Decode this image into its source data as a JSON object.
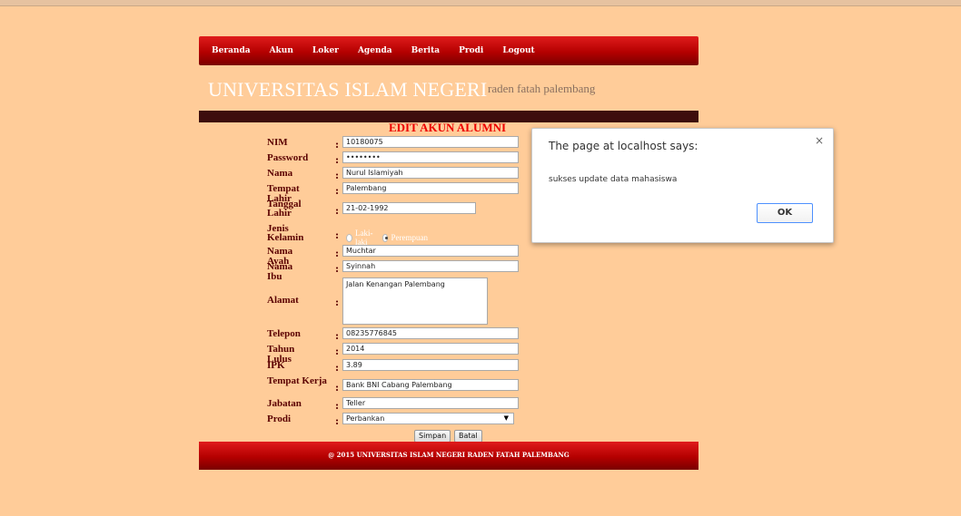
{
  "nav": {
    "items": [
      "Beranda",
      "Akun",
      "Loker",
      "Agenda",
      "Berita",
      "Prodi",
      "Logout"
    ]
  },
  "header": {
    "title": "UNIVERSITAS ISLAM NEGERI",
    "subtitle": "raden fatah palembang"
  },
  "form": {
    "title": "EDIT AKUN ALUMNI",
    "colon": ":",
    "labels": {
      "nim": "NIM",
      "password": "Password",
      "nama": "Nama",
      "tempat_lahir": "Tempat Lahir",
      "tanggal_lahir": "Tanggal Lahir",
      "jenis_kelamin": "Jenis Kelamin",
      "nama_ayah": "Nama Ayah",
      "nama_ibu": "Nama Ibu",
      "alamat": "Alamat",
      "telepon": "Telepon",
      "tahun_lulus": "Tahun Lulus",
      "ipk": "IPK",
      "tempat_kerja": "Tempat Kerja",
      "jabatan": "Jabatan",
      "prodi": "Prodi"
    },
    "values": {
      "nim": "10180075",
      "password": "••••••••",
      "nama": "Nurul Islamiyah",
      "tempat_lahir": "Palembang",
      "tanggal_lahir": "21-02-1992",
      "nama_ayah": "Muchtar",
      "nama_ibu": "Syinnah",
      "alamat": "Jalan Kenangan Palembang",
      "telepon": "08235776845",
      "tahun_lulus": "2014",
      "ipk": "3.89",
      "tempat_kerja": "Bank BNI Cabang Palembang",
      "jabatan": "Teller",
      "prodi": "Perbankan"
    },
    "gender": {
      "male": "Laki-laki",
      "female": "Perempuan",
      "selected": "female"
    },
    "buttons": {
      "save": "Simpan",
      "cancel": "Batal"
    }
  },
  "footer": {
    "text": "@ 2015 UNIVERSITAS ISLAM NEGERI RADEN FATAH PALEMBANG"
  },
  "dialog": {
    "title": "The page at localhost says:",
    "message": "sukses update data mahasiswa",
    "ok": "OK",
    "close": "×"
  }
}
